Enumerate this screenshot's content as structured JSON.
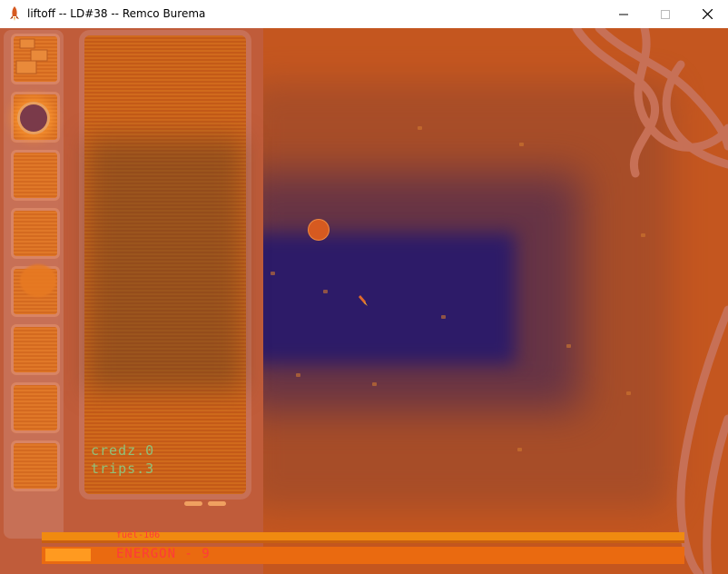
{
  "window": {
    "title": "liftoff -- LD#38 -- Remco Burema",
    "icon": "rocket-icon"
  },
  "controls": {
    "minimize_icon": "minimize-icon",
    "maximize_icon": "maximize-icon",
    "close_icon": "close-icon"
  },
  "stats": {
    "creds": "credz.0",
    "trips": "trips.3"
  },
  "hud": {
    "fuel": "fuel-106",
    "energon": "ENERGON - 9"
  },
  "colors": {
    "ground": "#c4551e",
    "pit_core": "#2a1a6a",
    "stat_text": "#8fc07a",
    "hud_text": "#ff3a3a",
    "hud_bar": "#ea6a10"
  }
}
